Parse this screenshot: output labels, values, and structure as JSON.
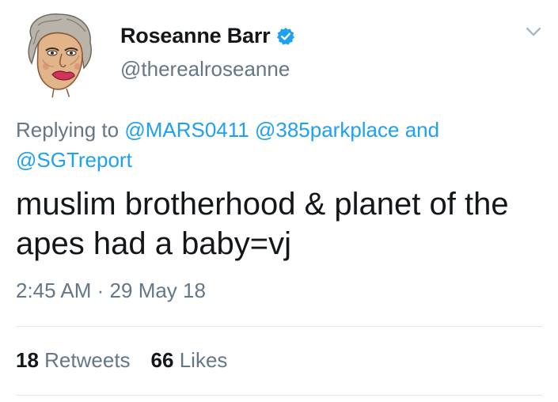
{
  "tweet": {
    "author": {
      "display_name": "Roseanne Barr",
      "handle": "@therealroseanne",
      "verified_icon": "verified-badge-icon",
      "avatar_icon": "caricature-avatar"
    },
    "menu_icon": "chevron-down-icon",
    "reply": {
      "prefix": "Replying to",
      "mentions": [
        "@MARS0411",
        "@385parkplace"
      ],
      "conjunction": "and",
      "last_mention": "@SGTreport"
    },
    "text": "muslim brotherhood & planet of the apes had a baby=vj",
    "time": "2:45 AM",
    "separator": "·",
    "date": "29 May 18",
    "stats": {
      "retweets_count": "18",
      "retweets_label": "Retweets",
      "likes_count": "66",
      "likes_label": "Likes"
    }
  },
  "colors": {
    "text": "#14171a",
    "secondary": "#657786",
    "accent": "#1da1f2",
    "divider": "#e1e8ed"
  }
}
